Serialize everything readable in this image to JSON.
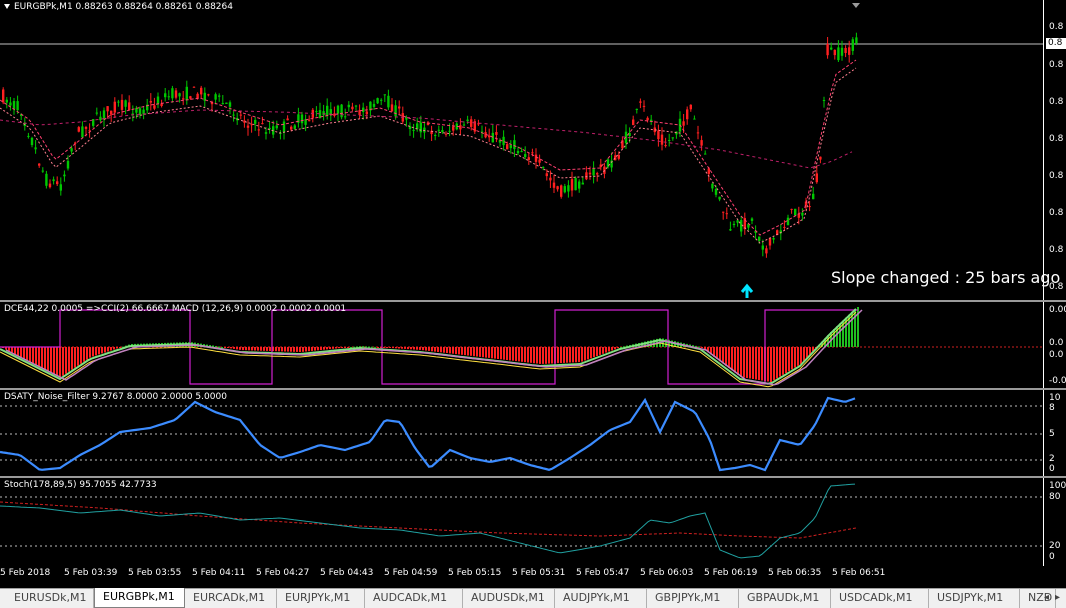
{
  "main": {
    "title": "EURGBPk,M1  0.88263 0.88264 0.88261 0.88264",
    "bid_box": "0.8",
    "price_ticks": [
      "0.8",
      "0.8",
      "0.8",
      "0.8",
      "0.8",
      "0.8",
      "0.8",
      "0.8",
      "0.8"
    ],
    "slope_text": "Slope changed : 25 bars ago",
    "colors": {
      "bull": "#00c800",
      "bear": "#ff2020",
      "ma_fast": "#ff4070",
      "ma_slow": "#c0206a",
      "arrow": "#00e5ff"
    }
  },
  "indicator1": {
    "title": "DCE44,22 0.0005  =>CCI(2) 66.6667  MACD (12,26,9) 0.0002 0.0002 0.0001",
    "ticks": [
      "0.00",
      "0.0",
      "0.0",
      "-0.0"
    ]
  },
  "indicator2": {
    "title": "DSATY_Noise_Filter  9.2767 8.0000 2.0000 5.0000",
    "ticks": [
      "10",
      "8",
      "5",
      "2",
      "0"
    ]
  },
  "indicator3": {
    "title": "Stoch(178,89,5) 95.7055 42.7733",
    "ticks": [
      "100",
      "80",
      "20",
      "0"
    ]
  },
  "time_axis": [
    "5 Feb 2018",
    "5 Feb 03:39",
    "5 Feb 03:55",
    "5 Feb 04:11",
    "5 Feb 04:27",
    "5 Feb 04:43",
    "5 Feb 04:59",
    "5 Feb 05:15",
    "5 Feb 05:31",
    "5 Feb 05:47",
    "5 Feb 06:03",
    "5 Feb 06:19",
    "5 Feb 06:35",
    "5 Feb 06:51"
  ],
  "tabs": [
    "EURUSDk,M1",
    "EURGBPk,M1",
    "EURCADk,M1",
    "EURJPYk,M1",
    "AUDCADk,M1",
    "AUDUSDk,M1",
    "AUDJPYk,M1",
    "GBPJPYk,M1",
    "GBPAUDk,M1",
    "USDCADk,M1",
    "USDJPYk,M1",
    "NZD"
  ],
  "active_tab": "EURGBPk,M1"
}
